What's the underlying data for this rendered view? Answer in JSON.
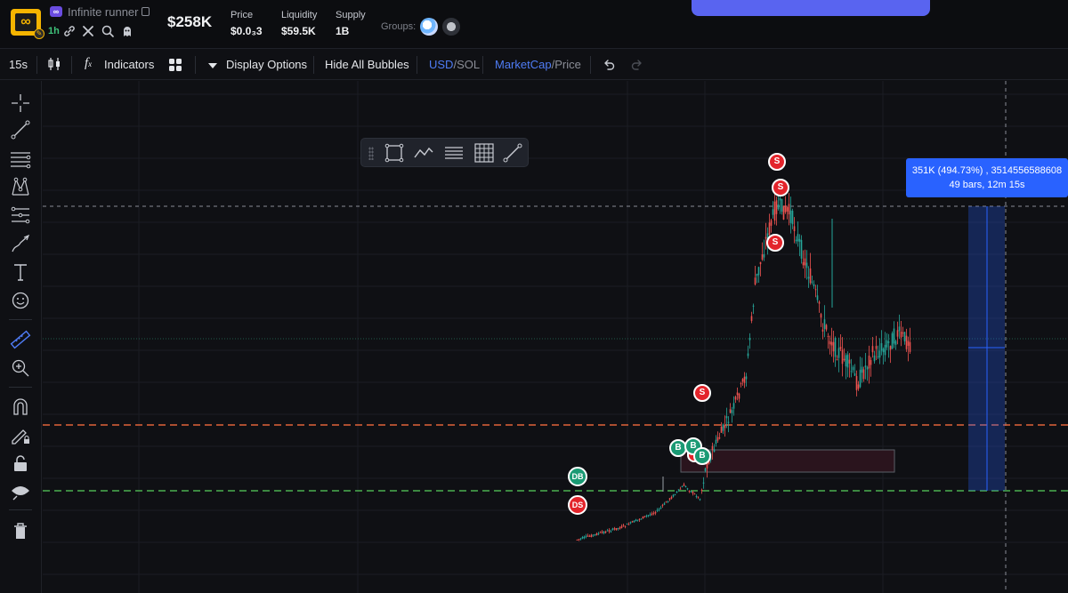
{
  "header": {
    "token_name": "Infinite runner",
    "name_chip": "∞",
    "avatar_glyph": "∞",
    "age": "1h",
    "market_cap": "$258K",
    "stats": [
      {
        "label": "Price",
        "value": "$0.0₃3"
      },
      {
        "label": "Liquidity",
        "value": "$59.5K"
      },
      {
        "label": "Supply",
        "value": "1B"
      }
    ],
    "groups_label": "Groups:",
    "icons": [
      "link-icon",
      "x-icon",
      "search-icon",
      "ghost-icon"
    ]
  },
  "toolbar": {
    "interval": "15s",
    "indicators": "Indicators",
    "display_options": "Display Options",
    "hide_bubbles": "Hide All Bubbles",
    "currency_active": "USD",
    "currency_inactive": "SOL",
    "mode_active": "MarketCap",
    "mode_inactive": "Price",
    "separator": "/"
  },
  "measure": {
    "line1": "351K (494.73%) , 3514556588608",
    "line2": "49 bars, 12m 15s"
  },
  "bubbles": [
    {
      "label": "S",
      "kind": "s"
    },
    {
      "label": "S",
      "kind": "s"
    },
    {
      "label": "S",
      "kind": "s"
    },
    {
      "label": "S",
      "kind": "s"
    },
    {
      "label": "B",
      "kind": "b"
    },
    {
      "label": "B",
      "kind": "b"
    },
    {
      "label": "B",
      "kind": "b"
    },
    {
      "label": "DB",
      "kind": "b"
    },
    {
      "label": "DS",
      "kind": "s"
    }
  ],
  "colors": {
    "accent": "#4f7cf5",
    "sell": "#e3242b",
    "buy": "#1a9a74",
    "candle_up": "#26a69a",
    "candle_down": "#ef5350",
    "orange_line": "#e0623a",
    "green_line": "#4caf50",
    "measure_blue": "#2962ff"
  }
}
